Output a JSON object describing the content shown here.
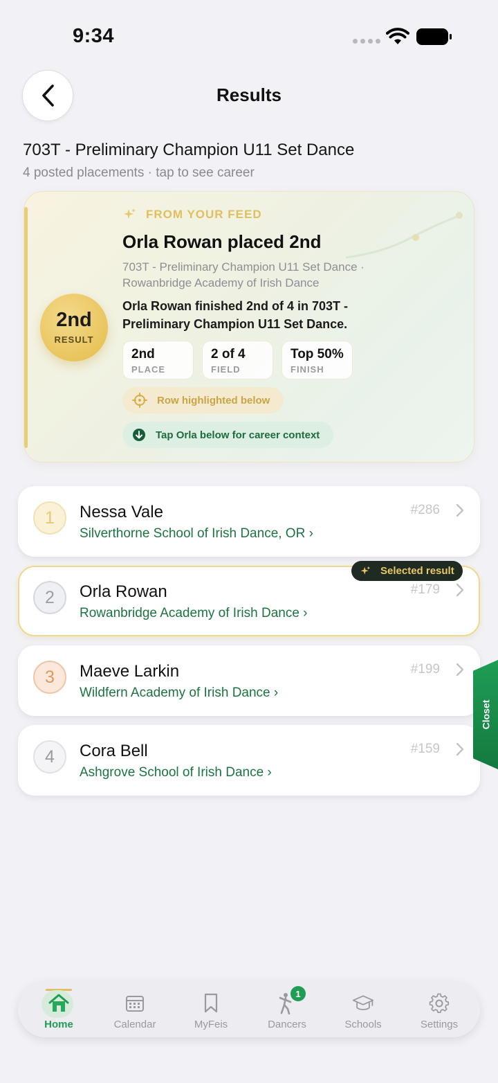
{
  "status": {
    "time": "9:34"
  },
  "header": {
    "title": "Results"
  },
  "event": {
    "title": "703T - Preliminary Champion U11 Set Dance",
    "subtitle": "4 posted placements · tap to see career"
  },
  "feed_card": {
    "eyebrow": "FROM YOUR FEED",
    "headline": "Orla Rowan placed 2nd",
    "meta": "703T - Preliminary Champion U11 Set Dance · Rowanbridge Academy of Irish Dance",
    "summary": "Orla Rowan finished 2nd of 4 in 703T - Preliminary Champion U11 Set Dance.",
    "medal": {
      "rank": "2nd",
      "caption": "RESULT"
    },
    "stats": [
      {
        "value": "2nd",
        "label": "PLACE"
      },
      {
        "value": "2 of 4",
        "label": "FIELD"
      },
      {
        "value": "Top 50%",
        "label": "FINISH"
      }
    ],
    "highlight_pill": "Row highlighted below",
    "tap_pill": "Tap Orla below for career context",
    "colors": {
      "gold": "#e0bf5e",
      "green": "#1d6b3e"
    }
  },
  "results": [
    {
      "rank": "1",
      "name": "Nessa Vale",
      "school": "Silverthorne School of Irish Dance, OR",
      "number": "#286",
      "rank_bg": "#fbf1d6",
      "rank_color": "#e6c977",
      "rank_border": "#f1e2b4"
    },
    {
      "rank": "2",
      "name": "Orla Rowan",
      "school": "Rowanbridge Academy of Irish Dance",
      "number": "#179",
      "rank_bg": "#eef0f3",
      "rank_color": "#9aa0a8",
      "rank_border": "#d4d8de"
    },
    {
      "rank": "3",
      "name": "Maeve Larkin",
      "school": "Wildfern Academy of Irish Dance",
      "number": "#199",
      "rank_bg": "#fbe8da",
      "rank_color": "#d99a63",
      "rank_border": "#efc7a7"
    },
    {
      "rank": "4",
      "name": "Cora Bell",
      "school": "Ashgrove School of Irish Dance",
      "number": "#159",
      "rank_bg": "#f4f4f6",
      "rank_color": "#9a9a9e",
      "rank_border": "#e2e2e6"
    }
  ],
  "selected_badge": "Selected result",
  "closet_tab": "Closet",
  "tabs": [
    {
      "label": "Home",
      "icon": "home-icon",
      "active": true
    },
    {
      "label": "Calendar",
      "icon": "calendar-icon"
    },
    {
      "label": "MyFeis",
      "icon": "bookmark-icon"
    },
    {
      "label": "Dancers",
      "icon": "dancer-icon",
      "badge": "1"
    },
    {
      "label": "Schools",
      "icon": "graduation-cap-icon"
    },
    {
      "label": "Settings",
      "icon": "gear-icon"
    }
  ]
}
